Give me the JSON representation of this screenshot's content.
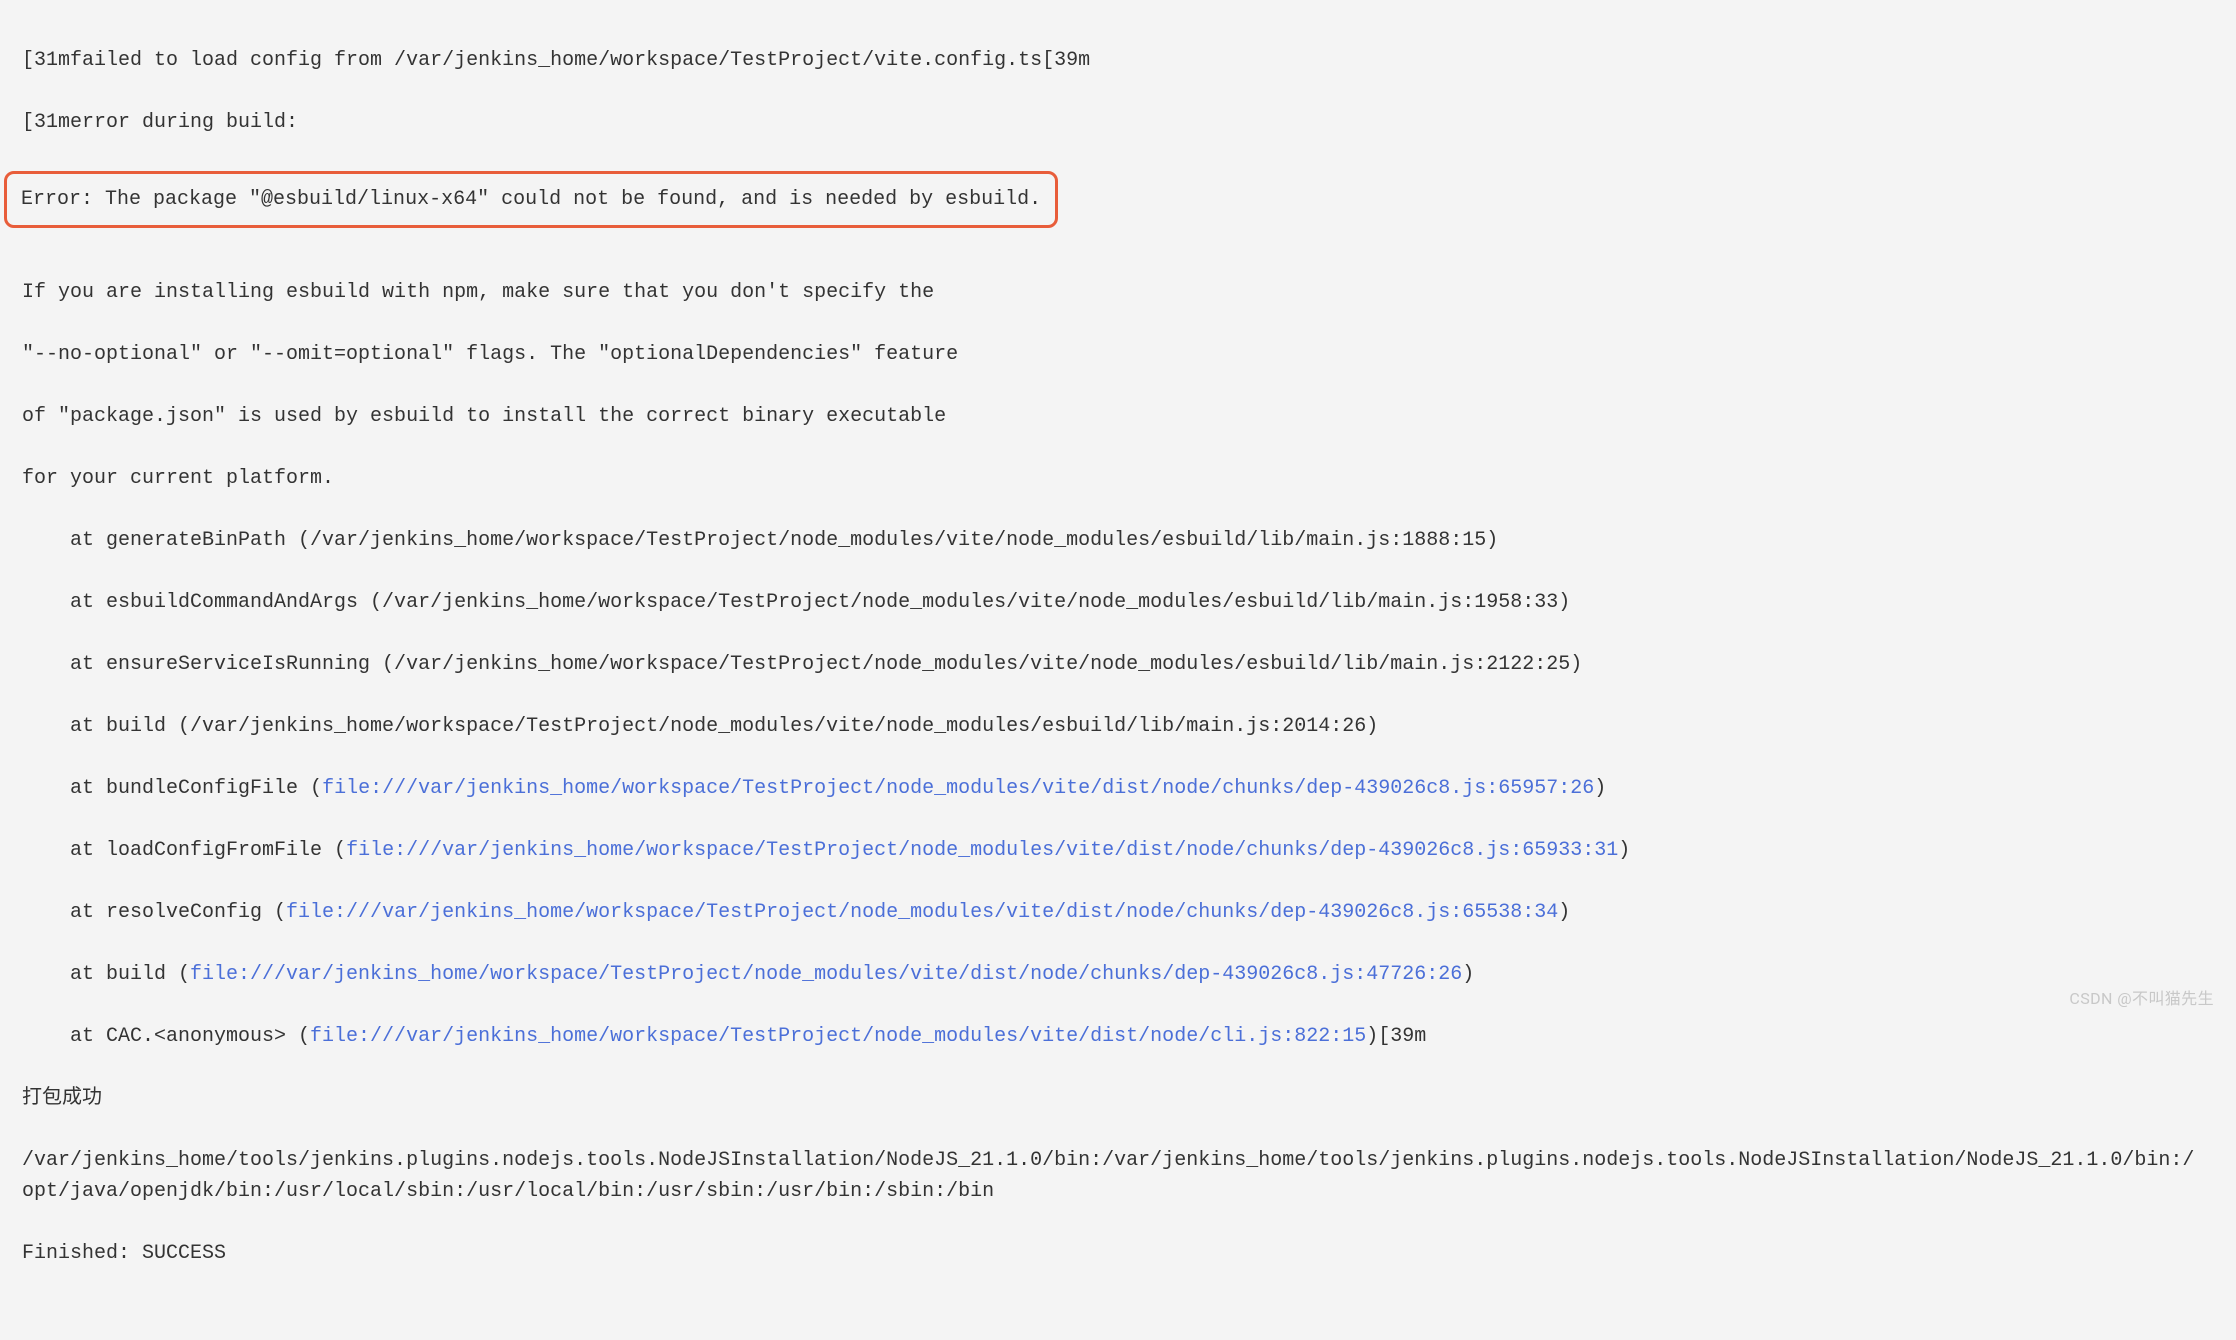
{
  "lines": {
    "l1": "[31mfailed to load config from /var/jenkins_home/workspace/TestProject/vite.config.ts[39m",
    "l2": "[31merror during build:",
    "l3_box": "Error: The package \"@esbuild/linux-x64\" could not be found, and is needed by esbuild.",
    "l4": "If you are installing esbuild with npm, make sure that you don't specify the",
    "l5": "\"--no-optional\" or \"--omit=optional\" flags. The \"optionalDependencies\" feature",
    "l6": "of \"package.json\" is used by esbuild to install the correct binary executable",
    "l7": "for your current platform.",
    "s1": "    at generateBinPath (/var/jenkins_home/workspace/TestProject/node_modules/vite/node_modules/esbuild/lib/main.js:1888:15)",
    "s2": "    at esbuildCommandAndArgs (/var/jenkins_home/workspace/TestProject/node_modules/vite/node_modules/esbuild/lib/main.js:1958:33)",
    "s3": "    at ensureServiceIsRunning (/var/jenkins_home/workspace/TestProject/node_modules/vite/node_modules/esbuild/lib/main.js:2122:25)",
    "s4": "    at build (/var/jenkins_home/workspace/TestProject/node_modules/vite/node_modules/esbuild/lib/main.js:2014:26)",
    "s5_pre": "    at bundleConfigFile (",
    "s5_link": "file:///var/jenkins_home/workspace/TestProject/node_modules/vite/dist/node/chunks/dep-439026c8.js:65957:26",
    "s5_post": ")",
    "s6_pre": "    at loadConfigFromFile (",
    "s6_link": "file:///var/jenkins_home/workspace/TestProject/node_modules/vite/dist/node/chunks/dep-439026c8.js:65933:31",
    "s6_post": ")",
    "s7_pre": "    at resolveConfig (",
    "s7_link": "file:///var/jenkins_home/workspace/TestProject/node_modules/vite/dist/node/chunks/dep-439026c8.js:65538:34",
    "s7_post": ")",
    "s8_pre": "    at build (",
    "s8_link": "file:///var/jenkins_home/workspace/TestProject/node_modules/vite/dist/node/chunks/dep-439026c8.js:47726:26",
    "s8_post": ")",
    "s9_pre": "    at CAC.<anonymous> (",
    "s9_link": "file:///var/jenkins_home/workspace/TestProject/node_modules/vite/dist/node/cli.js:822:15",
    "s9_post": ")[39m",
    "success": "打包成功",
    "path": "/var/jenkins_home/tools/jenkins.plugins.nodejs.tools.NodeJSInstallation/NodeJS_21.1.0/bin:/var/jenkins_home/tools/jenkins.plugins.nodejs.tools.NodeJSInstallation/NodeJS_21.1.0/bin:/opt/java/openjdk/bin:/usr/local/sbin:/usr/local/bin:/usr/sbin:/usr/bin:/sbin:/bin",
    "finished": "Finished: SUCCESS"
  },
  "watermark": "CSDN @不叫猫先生"
}
